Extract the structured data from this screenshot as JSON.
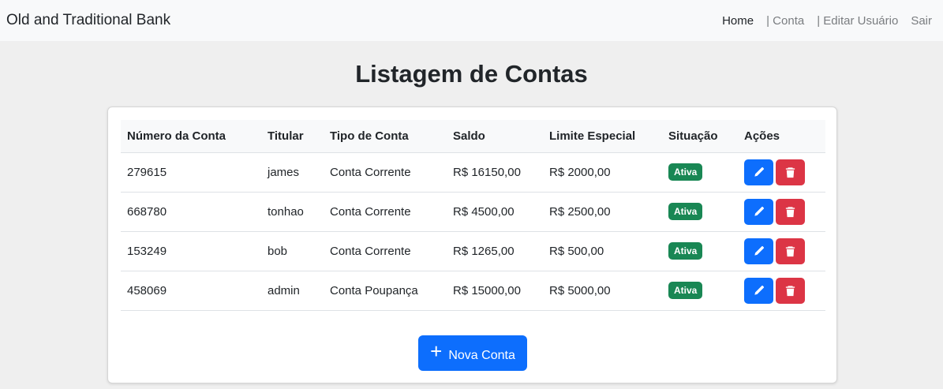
{
  "nav": {
    "brand": "Old and Traditional Bank",
    "home": "Home",
    "conta": "| Conta",
    "editar": "| Editar Usuário",
    "sair": "Sair"
  },
  "page": {
    "title": "Listagem de Contas"
  },
  "table": {
    "headers": [
      "Número da Conta",
      "Titular",
      "Tipo de Conta",
      "Saldo",
      "Limite Especial",
      "Situação",
      "Ações"
    ],
    "rows": [
      {
        "numero": "279615",
        "titular": "james",
        "tipo": "Conta Corrente",
        "saldo": "R$ 16150,00",
        "limite": "R$ 2000,00",
        "situacao": "Ativa"
      },
      {
        "numero": "668780",
        "titular": "tonhao",
        "tipo": "Conta Corrente",
        "saldo": "R$ 4500,00",
        "limite": "R$ 2500,00",
        "situacao": "Ativa"
      },
      {
        "numero": "153249",
        "titular": "bob",
        "tipo": "Conta Corrente",
        "saldo": "R$ 1265,00",
        "limite": "R$ 500,00",
        "situacao": "Ativa"
      },
      {
        "numero": "458069",
        "titular": "admin",
        "tipo": "Conta Poupança",
        "saldo": "R$ 15000,00",
        "limite": "R$ 5000,00",
        "situacao": "Ativa"
      }
    ]
  },
  "actions": {
    "new_button_icon": "+",
    "new_button_label": "Nova Conta",
    "edit_icon": "pencil-icon",
    "delete_icon": "trash-icon"
  },
  "colors": {
    "primary": "#0d6efd",
    "danger": "#dc3545",
    "success": "#198754",
    "navbar_bg": "#f8f9fa",
    "page_bg": "#efefef"
  }
}
